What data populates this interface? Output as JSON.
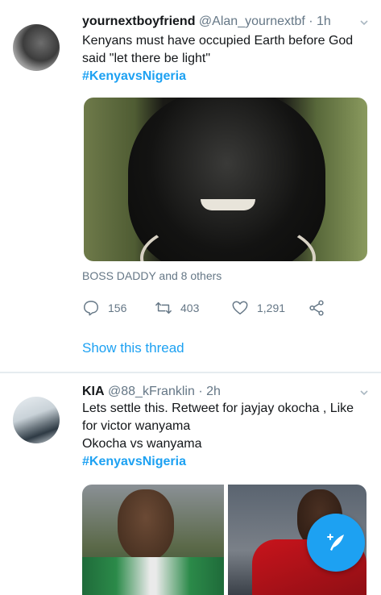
{
  "tweets": [
    {
      "name": "yournextboyfriend",
      "handle": "@Alan_yournextbf",
      "separator": "·",
      "time": "1h",
      "text_lines": [
        "Kenyans must have occupied Earth before God",
        "said \"let there be light\""
      ],
      "hashtag": "#KenyavsNigeria",
      "social_context": "BOSS DADDY and 8 others",
      "replies": "156",
      "retweets": "403",
      "likes": "1,291",
      "show_thread": "Show this thread"
    },
    {
      "name": "KIA",
      "handle": "@88_kFranklin",
      "separator": "·",
      "time": "2h",
      "text_lines": [
        "Lets settle this. Retweet for jayjay okocha , Like",
        "for victor wanyama",
        "Okocha vs wanyama"
      ],
      "hashtag": "#KenyavsNigeria"
    }
  ],
  "colors": {
    "accent": "#1da1f2",
    "secondary_text": "#657786",
    "primary_text": "#14171a"
  },
  "icons": {
    "reply": "reply-icon",
    "retweet": "retweet-icon",
    "like": "heart-icon",
    "share": "share-icon",
    "more": "chevron-down-icon",
    "compose": "compose-tweet-icon"
  }
}
